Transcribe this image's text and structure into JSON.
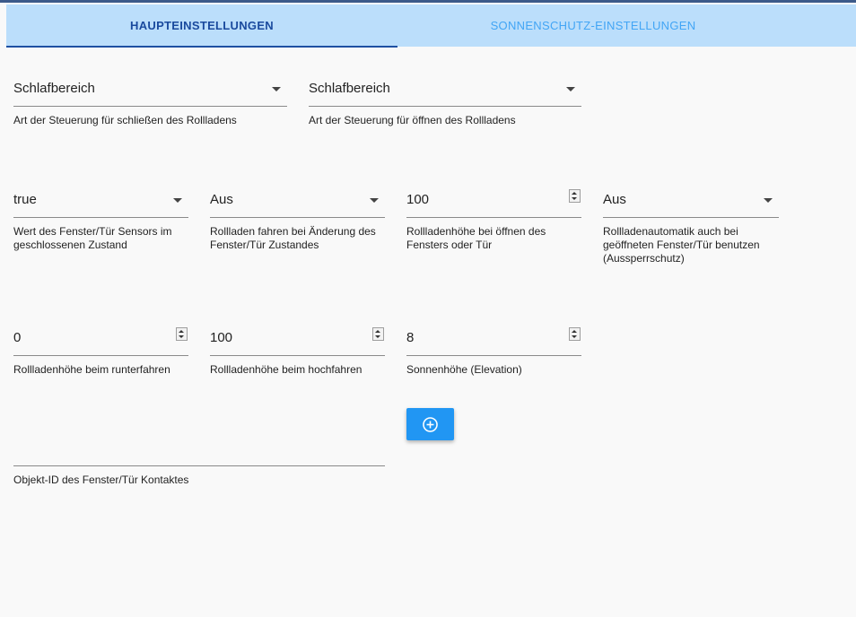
{
  "tabs": {
    "main": "HAUPTEINSTELLUNGEN",
    "sunprotect": "SONNENSCHUTZ-EINSTELLUNGEN"
  },
  "fields": {
    "close_control": {
      "value": "Schlafbereich",
      "label": "Art der Steuerung für schließen des Rollladens"
    },
    "open_control": {
      "value": "Schlafbereich",
      "label": "Art der Steuerung für öffnen des Rollladens"
    },
    "window_sensor_value": {
      "value": "true",
      "label": "Wert des Fenster/Tür Sensors im geschlossenen Zustand"
    },
    "drive_on_change": {
      "value": "Aus",
      "label": "Rollladen fahren bei Änderung des Fenster/Tür Zustandes"
    },
    "height_on_open": {
      "value": "100",
      "label": "Rollladenhöhe bei öffnen des Fensters oder Tür"
    },
    "lockout_protection": {
      "value": "Aus",
      "label": "Rollladenautomatik auch bei geöffneten Fenster/Tür benutzen (Aussperrschutz)"
    },
    "height_down": {
      "value": "0",
      "label": "Rollladenhöhe beim runterfahren"
    },
    "height_up": {
      "value": "100",
      "label": "Rollladenhöhe beim hochfahren"
    },
    "sun_elevation": {
      "value": "8",
      "label": "Sonnenhöhe (Elevation)"
    }
  },
  "object_id": {
    "label": "Objekt-ID des Fenster/Tür Kontaktes"
  },
  "icons": {
    "add": "add-circle-icon",
    "dropdown": "caret-down-icon",
    "spinner": "number-spinner-icon"
  },
  "colors": {
    "tab_bar": "#bbdefb",
    "tab_active": "#1a4a9e",
    "tab_inactive": "#42a5f5",
    "button": "#2196f3"
  }
}
